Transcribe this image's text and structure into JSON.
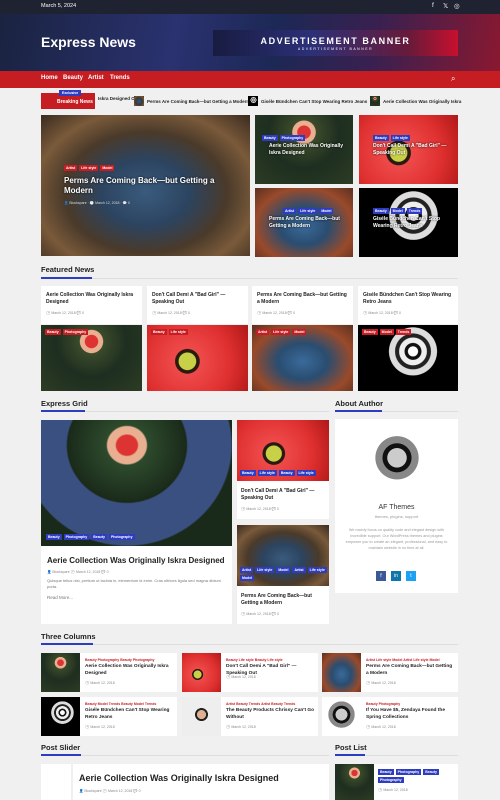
{
  "topbar": {
    "date": "March 5, 2024",
    "social": [
      "f",
      "t",
      "ig"
    ]
  },
  "site": {
    "name": "Express News"
  },
  "ad": {
    "line1": "ADVERTISEMENT BANNER",
    "line2": "ADVERTISEMENT BANNER"
  },
  "nav": {
    "items": [
      "Home",
      "Beauty",
      "Artist",
      "Trends"
    ]
  },
  "ticker": {
    "exclusive": "Exclusive",
    "breaking": "Breaking News",
    "items": [
      "Iskra Designed Out",
      "Perms Are Coming Back—but Getting a Modern",
      "Giséle Bündchen Can't Stop Wearing Retro Jeans",
      "Aerie Collection Was Originally Iskra"
    ]
  },
  "hero": {
    "main": {
      "tags": [
        "Artist",
        "Life style",
        "Model"
      ],
      "title": "Perms Are Coming Back—but Getting a Modern",
      "author": "Blockspare",
      "date": "March 12, 2018",
      "comments": "0"
    },
    "side": [
      {
        "tags": [
          "Beauty",
          "Photography"
        ],
        "title": "Aerie Collection Was Originally Iskra Designed"
      },
      {
        "tags": [
          "Beauty",
          "Life style"
        ],
        "title": "Don't Call Demi A \"Bad Girl\" — Speaking Out"
      },
      {
        "tags": [
          "Artist",
          "Life style",
          "Model"
        ],
        "title": "Perms Are Coming Back—but Getting a Modern"
      },
      {
        "tags": [
          "Beauty",
          "Model",
          "Trends"
        ],
        "title": "Giséle Bündchen Can't Stop Wearing Retro Jeans"
      }
    ]
  },
  "featured": {
    "title": "Featured News",
    "items": [
      {
        "title": "Aerie Collection Was Originally Iskra Designed",
        "date": "March 12, 2018",
        "comments": "0",
        "tags": [
          "Beauty",
          "Photography"
        ]
      },
      {
        "title": "Don't Call Demi A \"Bad Girl\" — Speaking Out",
        "date": "March 12, 2018",
        "comments": "0",
        "tags": [
          "Beauty",
          "Life style"
        ]
      },
      {
        "title": "Perms Are Coming Back—but Getting a Modern",
        "date": "March 12, 2018",
        "comments": "0",
        "tags": [
          "Artist",
          "Life style",
          "Model"
        ]
      },
      {
        "title": "Giséle Bündchen Can't Stop Wearing Retro Jeans",
        "date": "March 12, 2018",
        "comments": "0",
        "tags": [
          "Beauty",
          "Model",
          "Trends"
        ]
      }
    ]
  },
  "grid": {
    "title": "Express Grid",
    "main": {
      "tags": [
        "Beauty",
        "Photography",
        "Beauty",
        "Photography"
      ],
      "title": "Aerie Collection Was Originally Iskra Designed",
      "author": "Blockspare",
      "date": "March 12, 2018",
      "comments": "0",
      "excerpt": "Quisque tellus nisi, pretium ut lacinia in, elementum id enim. Cras ultrices ligula sed magna dictum porta.",
      "readmore": "Read More..."
    },
    "side": [
      {
        "tags": [
          "Beauty",
          "Life style",
          "Beauty",
          "Life style"
        ],
        "title": "Don't Call Demi A \"Bad Girl\" — Speaking Out",
        "date": "March 12, 2018",
        "comments": "0"
      },
      {
        "tags": [
          "Artist",
          "Life style",
          "Model",
          "Artist",
          "Life style",
          "Model"
        ],
        "title": "Perms Are Coming Back—but Getting a Modern",
        "date": "March 12, 2018",
        "comments": "0"
      }
    ]
  },
  "about": {
    "title": "About Author",
    "name": "AF Themes",
    "subtitle": "themes, plugins, support",
    "text": "We mainly focus on quality code and elegant design with incredible support. Our WordPress themes and plugins empower you to create an elegant, professional, and easy to maintain website in no time at all.",
    "social": [
      "f",
      "in",
      "t"
    ]
  },
  "three": {
    "title": "Three Columns",
    "items": [
      {
        "tags": "Beauty  Photography  Beauty  Photography",
        "title": "Aerie Collection Was Originally Iskra Designed",
        "date": "March 12, 2018"
      },
      {
        "tags": "Beauty  Life style  Beauty  Life style",
        "title": "Don't Call Demi A \"Bad Girl\" — Speaking Out",
        "date": "March 12, 2018"
      },
      {
        "tags": "Artist  Life style  Model  Artist  Life style  Model",
        "title": "Perms Are Coming Back—but Getting a Modern",
        "date": "March 12, 2018"
      },
      {
        "tags": "Beauty  Model  Trends  Beauty  Model  Trends",
        "title": "Giséle Bündchen Can't Stop Wearing Retro Jeans",
        "date": "March 12, 2018"
      },
      {
        "tags": "Artist  Beauty  Trends  Artist  Beauty  Trends",
        "title": "The Beauty Products Chrissy Can't Go Without",
        "date": "March 12, 2018"
      },
      {
        "tags": "Beauty  Photography",
        "title": "If You Have $5, Zendaya Found the Spring Collections",
        "date": "March 12, 2018"
      }
    ]
  },
  "postslider": {
    "title": "Post Slider",
    "item": {
      "title": "Aerie Collection Was Originally Iskra Designed",
      "author": "Blockspare",
      "date": "March 12, 2018",
      "comments": "0"
    }
  },
  "postlist": {
    "title": "Post List",
    "item": {
      "tags": [
        "Beauty",
        "Photography",
        "Beauty",
        "Photography"
      ],
      "date": "March 12, 2018"
    }
  },
  "colors": {
    "red": "#c61d23",
    "blue": "#2e3cc1",
    "dark": "#1f2230"
  }
}
